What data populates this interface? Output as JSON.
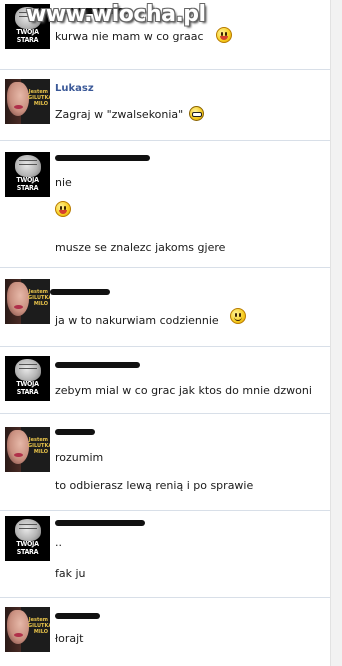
{
  "watermark": "www.wiocha.pl",
  "messages": [
    {
      "sender": "",
      "avatar": {
        "type": "twoja-stara",
        "text": "TWOJA STARA"
      },
      "lines": [
        "kurwa nie mam w co graac"
      ]
    },
    {
      "sender": "Lukasz",
      "avatar": {
        "type": "girl",
        "text": "Jestem GILUTKA MILO"
      },
      "lines": [
        "Zagraj w \"zwalsekonia\""
      ]
    },
    {
      "sender": "",
      "avatar": {
        "type": "twoja-stara",
        "text": "TWOJA STARA"
      },
      "lines": [
        "nie",
        "",
        "musze se znalezc jakoms gjere"
      ]
    },
    {
      "sender": "",
      "avatar": {
        "type": "girl",
        "text": "Jestem GILUTKA MILO"
      },
      "lines": [
        "ja w to nakurwiam codziennie"
      ]
    },
    {
      "sender": "",
      "avatar": {
        "type": "twoja-stara",
        "text": "TWOJA STARA"
      },
      "lines": [
        "zebym mial w co grac jak ktos do mnie dzwoni"
      ]
    },
    {
      "sender": "",
      "avatar": {
        "type": "girl",
        "text": "Jestem GILUTKA MILO"
      },
      "lines": [
        "rozumim",
        "to odbierasz lewą renią i po sprawie"
      ]
    },
    {
      "sender": "",
      "avatar": {
        "type": "twoja-stara",
        "text": "TWOJA STARA"
      },
      "lines": [
        "..",
        "fak ju"
      ]
    },
    {
      "sender": "",
      "avatar": {
        "type": "girl",
        "text": "Jestem GILUTKA MILO"
      },
      "lines": [
        "łorajt"
      ]
    }
  ]
}
